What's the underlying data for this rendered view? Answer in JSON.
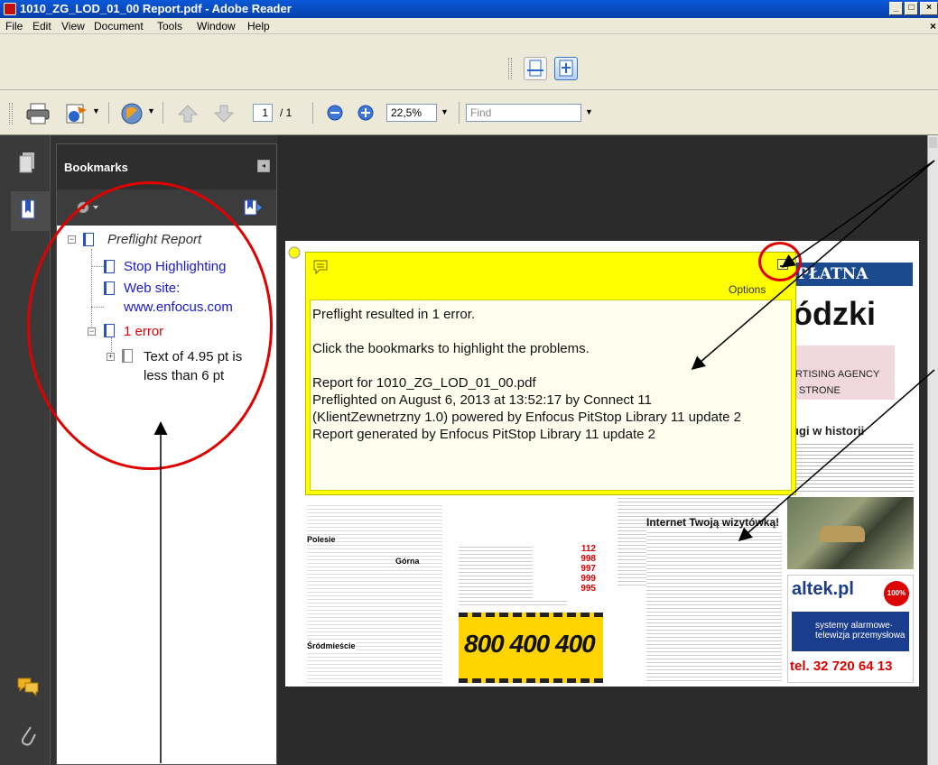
{
  "window": {
    "title": "1010_ZG_LOD_01_00 Report.pdf - Adobe Reader",
    "minimize": "_",
    "maximize": "□",
    "close": "×"
  },
  "menu": {
    "items": [
      "File",
      "Edit",
      "View",
      "Document",
      "Tools",
      "Window",
      "Help"
    ],
    "close_doc": "×"
  },
  "toolbar": {
    "page_current": "1",
    "page_total": "/ 1",
    "zoom": "22,5%",
    "find_placeholder": "Find"
  },
  "bookmarks": {
    "title": "Bookmarks",
    "items": [
      {
        "label": "Preflight Report",
        "color": "#333333",
        "italic": true
      },
      {
        "label": "Stop Highlighting",
        "color": "#1a1acd"
      },
      {
        "label": "Web site:",
        "label2": "www.enfocus.com",
        "color": "#1a1acd"
      },
      {
        "label": "1 error",
        "color": "#e00000"
      },
      {
        "label": "Text of 4.95 pt is",
        "label2": "less than 6 pt",
        "color": "#111111"
      }
    ]
  },
  "note": {
    "options": "Options",
    "lines": [
      "Preflight resulted in 1 error.",
      "",
      "Click the bookmarks to highlight the problems.",
      "",
      "Report for 1010_ZG_LOD_01_00.pdf",
      "Preflighted on August 6, 2013 at 13:52:17 by Connect 11",
      "(KlientZewnetrzny 1.0) powered by Enfocus PitStop Library 11 update 2",
      "Report generated by Enfocus PitStop Library 11 update 2"
    ]
  },
  "page_content": {
    "masthead_a": "PŁATNA",
    "masthead_b": "ódzki",
    "ad_agency_a": "RTISING AGENCY",
    "ad_agency_b": "STRONE",
    "headline": "rugi w historii",
    "phone_big": "800 400 400",
    "internet_heading": "Internet Twoją wizytówką!",
    "altek_logo": "altek.pl",
    "altek_badge": "100%",
    "altek_tagline1": "systemy alarmowe·",
    "altek_tagline2": "telewizja przemysłowa",
    "altek_phone": "tel. 32 720 64 13",
    "section_polesie": "Polesie",
    "section_gorna": "Górna",
    "section_srodmiescie": "Śródmieście",
    "small_numbers": [
      "112",
      "998",
      "997",
      "999",
      "995"
    ]
  },
  "colors": {
    "annotation": "#e00000",
    "note_yellow": "#ffff00",
    "link_blue": "#1a1acd",
    "error_red": "#e00000"
  }
}
